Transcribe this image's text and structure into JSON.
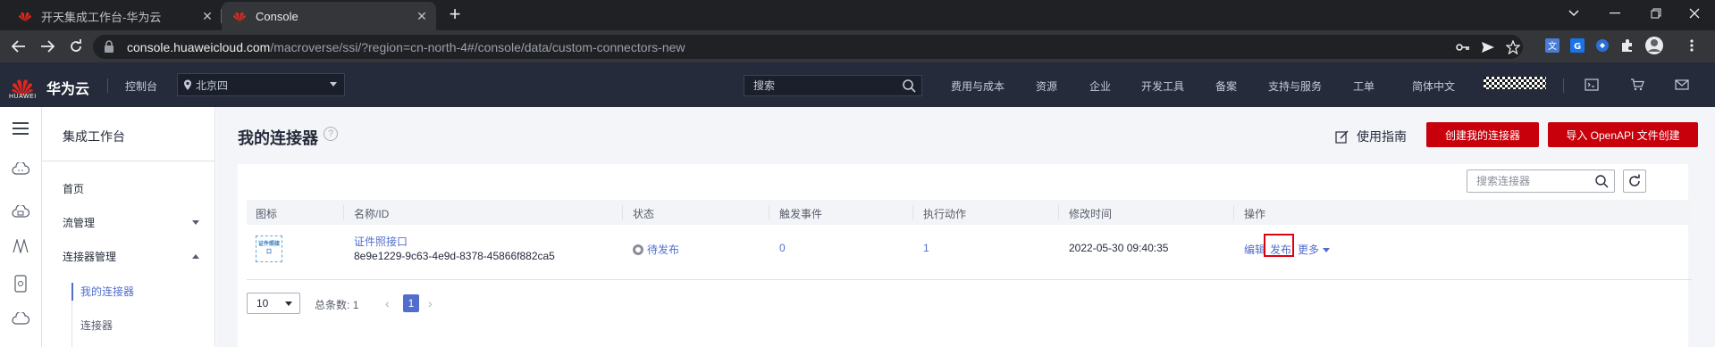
{
  "browser": {
    "tabs": [
      {
        "title": "开天集成工作台-华为云",
        "active": false
      },
      {
        "title": "Console",
        "active": true
      }
    ],
    "url_host": "console.huaweicloud.com",
    "url_path": "/macroverse/ssi/?region=cn-north-4#/console/data/custom-connectors-new"
  },
  "header": {
    "logo_text": "HUAWEI",
    "brand": "华为云",
    "console": "控制台",
    "region": "北京四",
    "search_placeholder": "搜索",
    "nav": [
      "费用与成本",
      "资源",
      "企业",
      "开发工具",
      "备案",
      "支持与服务",
      "工单",
      "简体中文"
    ]
  },
  "sidebar": {
    "title": "集成工作台",
    "items": [
      {
        "label": "首页"
      },
      {
        "label": "流管理"
      },
      {
        "label": "连接器管理"
      }
    ],
    "sub_items": [
      {
        "label": "我的连接器",
        "active": true
      },
      {
        "label": "连接器",
        "active": false
      }
    ]
  },
  "page": {
    "title": "我的连接器",
    "help": "?",
    "guide_label": "使用指南",
    "create_button": "创建我的连接器",
    "import_button": "导入 OpenAPI 文件创建",
    "search_placeholder": "搜索连接器"
  },
  "table": {
    "columns": [
      "图标",
      "名称/ID",
      "状态",
      "触发事件",
      "执行动作",
      "修改时间",
      "操作"
    ],
    "rows": [
      {
        "icon_text": "证件照接口",
        "name": "证件照接口",
        "id": "8e9e1229-9c63-4e9d-8378-45866f882ca5",
        "status": "待发布",
        "triggers": "0",
        "actions": "1",
        "modified": "2022-05-30 09:40:35",
        "op_edit": "编辑",
        "op_publish": "发布",
        "op_more": "更多"
      }
    ]
  },
  "pagination": {
    "page_size": "10",
    "total_label": "总条数:",
    "total": "1",
    "current_page": "1"
  },
  "colors": {
    "accent_red": "#c7000b",
    "link_blue": "#526ecc",
    "header_bg": "#252b3a"
  }
}
